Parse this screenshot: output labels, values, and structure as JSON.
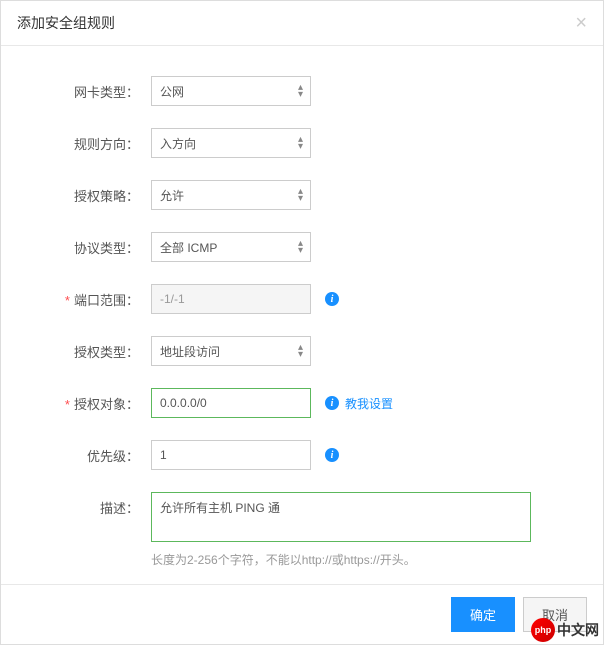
{
  "modal": {
    "title": "添加安全组规则"
  },
  "form": {
    "nic_type": {
      "label": "网卡类型：",
      "value": "公网"
    },
    "rule_direction": {
      "label": "规则方向：",
      "value": "入方向"
    },
    "auth_policy": {
      "label": "授权策略：",
      "value": "允许"
    },
    "protocol_type": {
      "label": "协议类型：",
      "value": "全部 ICMP"
    },
    "port_range": {
      "label": "端口范围：",
      "value": "-1/-1"
    },
    "auth_type": {
      "label": "授权类型：",
      "value": "地址段访问"
    },
    "auth_object": {
      "label": "授权对象：",
      "value": "0.0.0.0/0",
      "help": "教我设置"
    },
    "priority": {
      "label": "优先级：",
      "value": "1"
    },
    "description": {
      "label": "描述：",
      "value": "允许所有主机 PING 通",
      "hint": "长度为2-256个字符，不能以http://或https://开头。"
    }
  },
  "footer": {
    "confirm": "确定",
    "cancel": "取消"
  },
  "watermark": {
    "logo": "php",
    "text": "中文网"
  }
}
